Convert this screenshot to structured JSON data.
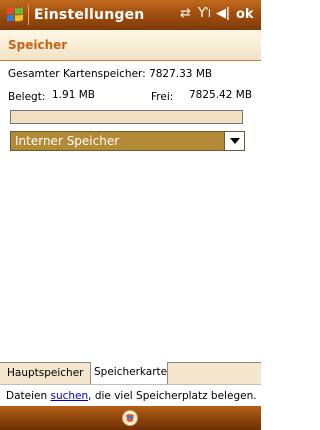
{
  "titlebar": {
    "title": "Einstellungen",
    "ok_label": "ok",
    "icons": [
      "start-flag-icon",
      "connectivity-icon",
      "signal-icon",
      "volume-icon"
    ]
  },
  "header": {
    "title": "Speicher"
  },
  "storage": {
    "total_label": "Gesamter Kartenspeicher:",
    "total_value": "7827.33 MB",
    "used_label": "Belegt:",
    "used_value": "1.91 MB",
    "free_label": "Frei:",
    "free_value": "7825.42 MB",
    "used_fraction": 0.0002
  },
  "combo": {
    "selected": "Interner Speicher"
  },
  "tabs": [
    {
      "label": "Hauptspeicher",
      "active": false
    },
    {
      "label": "Speicherkarte",
      "active": true
    }
  ],
  "hint": {
    "prefix": "Dateien ",
    "link": "suchen",
    "suffix": ", die viel Speicherplatz belegen."
  },
  "softkeys": {
    "center_icon": "keyboard-sip-icon"
  },
  "colors": {
    "titlebar": "#a24f10",
    "accent": "#c46416",
    "combo": "#b38a35"
  }
}
